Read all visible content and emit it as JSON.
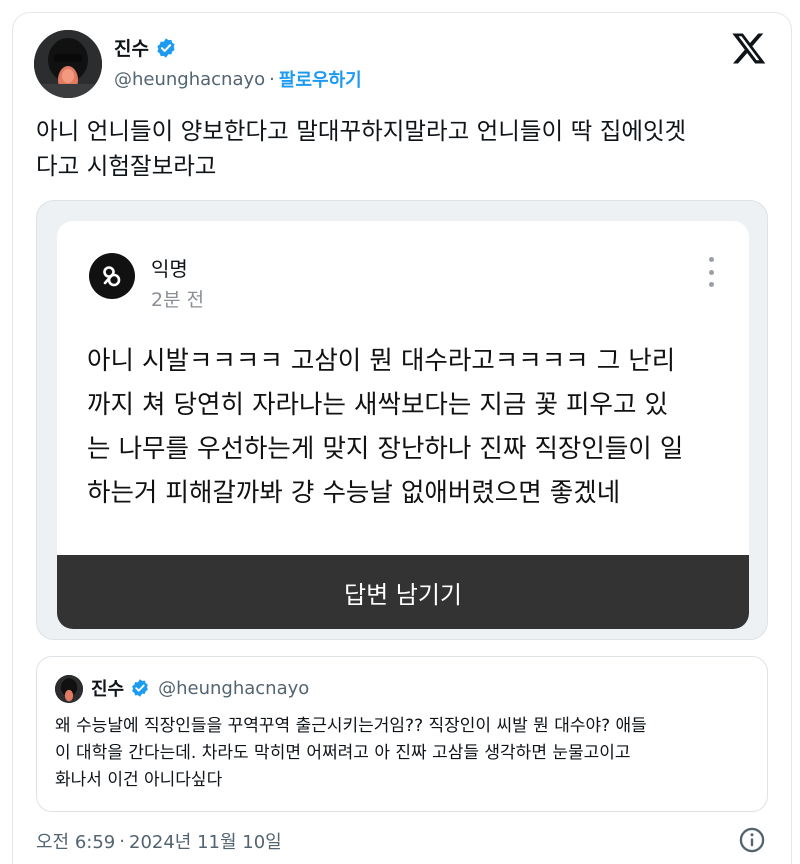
{
  "author": {
    "name": "진수",
    "handle": "@heunghacnayo",
    "follow_label": "팔로우하기",
    "verified_color": "#1d9bf0"
  },
  "separator": "·",
  "tweet": {
    "lines": [
      "아니 언니들이 양보한다고 말대꾸하지말라고 언니들이 딱 집에잇겟",
      "다고 시험잘보라고"
    ]
  },
  "embedded_post": {
    "author": "익명",
    "time": "2분 전",
    "body_lines": [
      "아니 시발ㅋㅋㅋㅋ 고삼이 뭔 대수라고ㅋㅋㅋㅋ 그 난리",
      "까지 쳐 당연히 자라나는 새싹보다는 지금 꽃 피우고 있",
      "는 나무를 우선하는게 맞지 장난하나 진짜 직장인들이 일",
      "하는거 피해갈까봐 걍 수능날 없애버렸으면 좋겠네"
    ],
    "reply_button": "답변 남기기"
  },
  "quoted_tweet": {
    "name": "진수",
    "handle": "@heunghacnayo",
    "lines": [
      "왜 수능날에 직장인들을 꾸역꾸역 출근시키는거임?? 직장인이 씨발 뭔 대수야? 애들",
      "이 대학을 간다는데. 차라도 막히면 어쩌려고 아 진짜 고삼들 생각하면 눈물고이고",
      "화나서 이건 아니다싶다"
    ]
  },
  "footer": {
    "time": "오전 6:59",
    "date": "2024년 11월 10일"
  },
  "icons": {
    "logo": "x-logo-icon",
    "verified": "verified-badge-icon",
    "more": "more-vertical-icon",
    "info": "info-icon"
  }
}
